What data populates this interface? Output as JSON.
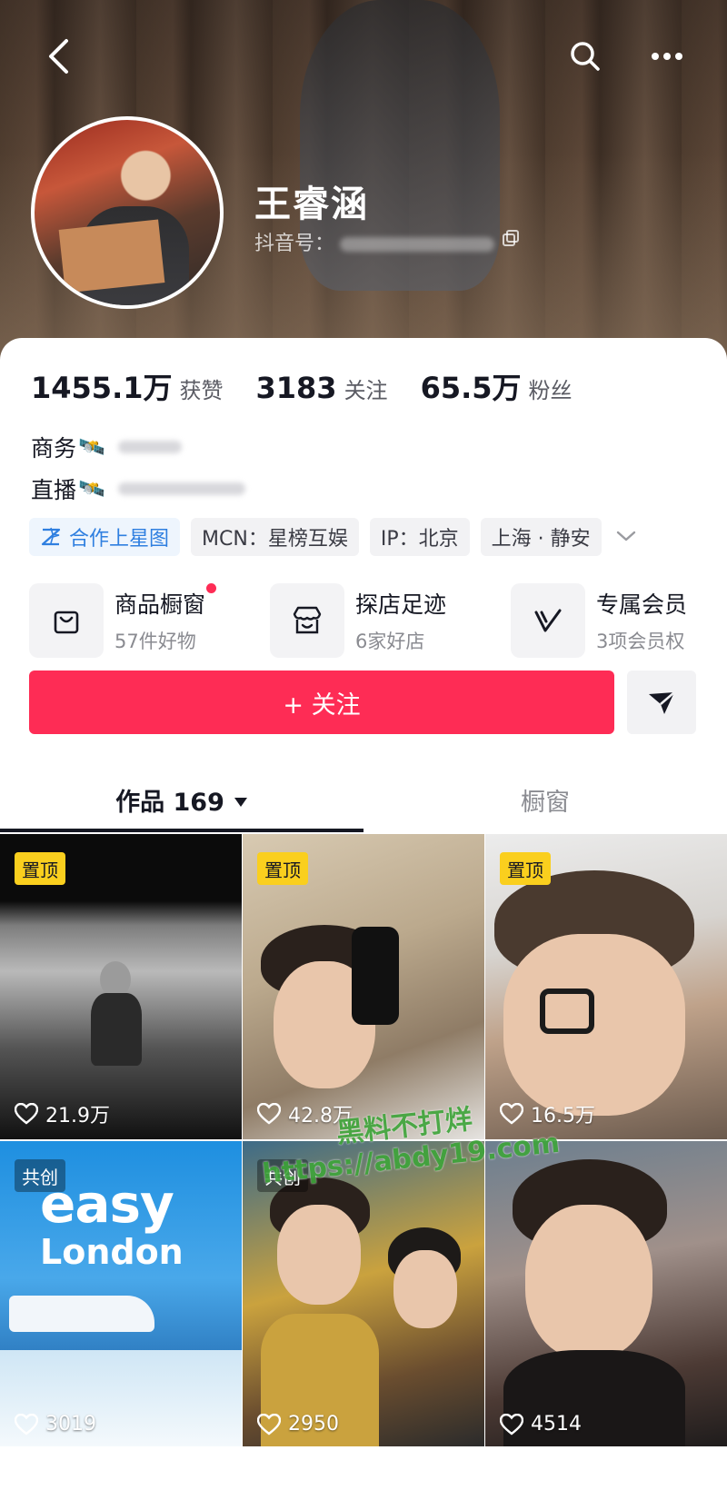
{
  "header": {
    "nickname": "王睿涵",
    "douyin_id_label": "抖音号："
  },
  "stats": [
    {
      "value": "1455.1万",
      "label": "获赞"
    },
    {
      "value": "3183",
      "label": "关注"
    },
    {
      "value": "65.5万",
      "label": "粉丝"
    }
  ],
  "contacts": [
    {
      "label": "商务",
      "emoji": "🛰️"
    },
    {
      "label": "直播",
      "emoji": "🛰️"
    }
  ],
  "tags": [
    {
      "label": "合作上星图"
    },
    {
      "label": "MCN：星榜互娱"
    },
    {
      "label": "IP：北京"
    },
    {
      "label": "上海 · 静安"
    }
  ],
  "services": [
    {
      "title": "商品橱窗",
      "sub": "57件好物",
      "icon": "bag-icon"
    },
    {
      "title": "探店足迹",
      "sub": "6家好店",
      "icon": "store-icon"
    },
    {
      "title": "专属会员",
      "sub": "3项会员权",
      "icon": "vip-icon"
    }
  ],
  "actions": {
    "follow_label": "+ 关注"
  },
  "tabs": [
    {
      "label": "作品 169"
    },
    {
      "label": "橱窗"
    }
  ],
  "videos": [
    {
      "badge": "置顶",
      "likes": "21.9万"
    },
    {
      "badge": "置顶",
      "likes": "42.8万"
    },
    {
      "badge": "置顶",
      "likes": "16.5万"
    },
    {
      "badge": "共创",
      "likes": "3019",
      "overlay_title": "easy",
      "overlay_sub": "London"
    },
    {
      "badge": "共创",
      "likes": "2950"
    },
    {
      "badge": "",
      "likes": "4514"
    }
  ],
  "watermark": {
    "line1": "黑料不打烊",
    "line2": "https://abdy19.com"
  },
  "colors": {
    "accent": "#fe2c55",
    "pin_badge": "#facf1e",
    "star_tag": "#2f7fe0"
  }
}
